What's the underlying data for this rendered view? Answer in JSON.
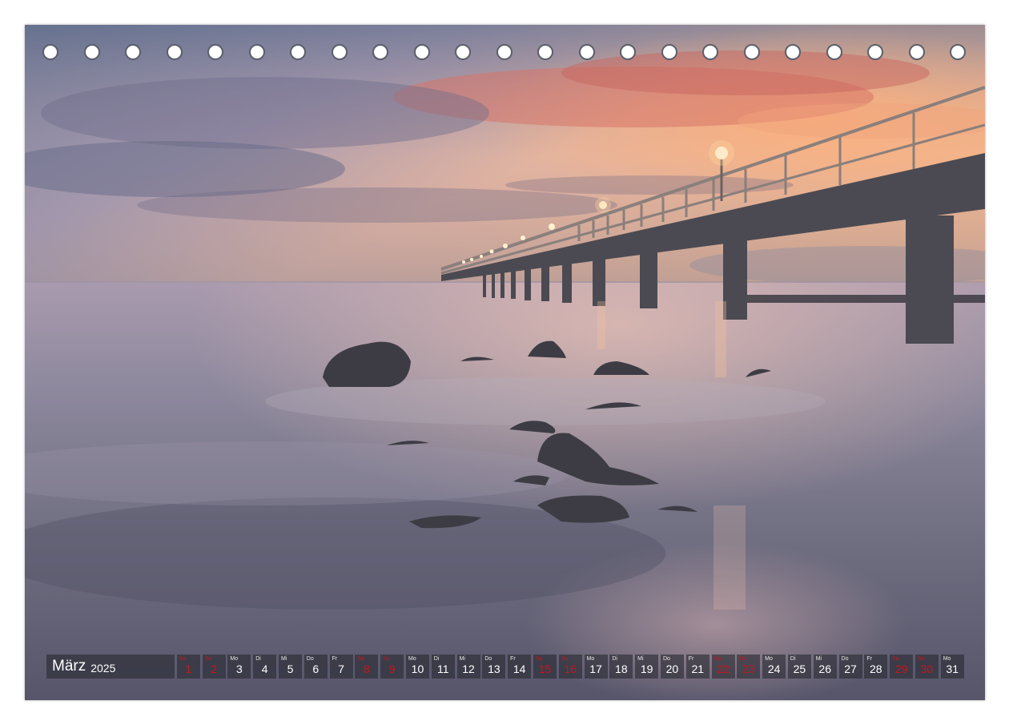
{
  "calendar": {
    "month": "März",
    "year": "2025",
    "weekend_color": "#c4161c",
    "days": [
      {
        "wd": "Sa",
        "num": "1",
        "weekend": true
      },
      {
        "wd": "So",
        "num": "2",
        "weekend": true
      },
      {
        "wd": "Mo",
        "num": "3",
        "weekend": false
      },
      {
        "wd": "Di",
        "num": "4",
        "weekend": false
      },
      {
        "wd": "Mi",
        "num": "5",
        "weekend": false
      },
      {
        "wd": "Do",
        "num": "6",
        "weekend": false
      },
      {
        "wd": "Fr",
        "num": "7",
        "weekend": false
      },
      {
        "wd": "Sa",
        "num": "8",
        "weekend": true
      },
      {
        "wd": "So",
        "num": "9",
        "weekend": true
      },
      {
        "wd": "Mo",
        "num": "10",
        "weekend": false
      },
      {
        "wd": "Di",
        "num": "11",
        "weekend": false
      },
      {
        "wd": "Mi",
        "num": "12",
        "weekend": false
      },
      {
        "wd": "Do",
        "num": "13",
        "weekend": false
      },
      {
        "wd": "Fr",
        "num": "14",
        "weekend": false
      },
      {
        "wd": "Sa",
        "num": "15",
        "weekend": true
      },
      {
        "wd": "So",
        "num": "16",
        "weekend": true
      },
      {
        "wd": "Mo",
        "num": "17",
        "weekend": false
      },
      {
        "wd": "Di",
        "num": "18",
        "weekend": false
      },
      {
        "wd": "Mi",
        "num": "19",
        "weekend": false
      },
      {
        "wd": "Do",
        "num": "20",
        "weekend": false
      },
      {
        "wd": "Fr",
        "num": "21",
        "weekend": false
      },
      {
        "wd": "Sa",
        "num": "22",
        "weekend": true
      },
      {
        "wd": "So",
        "num": "23",
        "weekend": true
      },
      {
        "wd": "Mo",
        "num": "24",
        "weekend": false
      },
      {
        "wd": "Di",
        "num": "25",
        "weekend": false
      },
      {
        "wd": "Mi",
        "num": "26",
        "weekend": false
      },
      {
        "wd": "Do",
        "num": "27",
        "weekend": false
      },
      {
        "wd": "Fr",
        "num": "28",
        "weekend": false
      },
      {
        "wd": "Sa",
        "num": "29",
        "weekend": true
      },
      {
        "wd": "So",
        "num": "30",
        "weekend": true
      },
      {
        "wd": "Mo",
        "num": "31",
        "weekend": false
      }
    ]
  },
  "binding": {
    "hole_count": 23
  }
}
